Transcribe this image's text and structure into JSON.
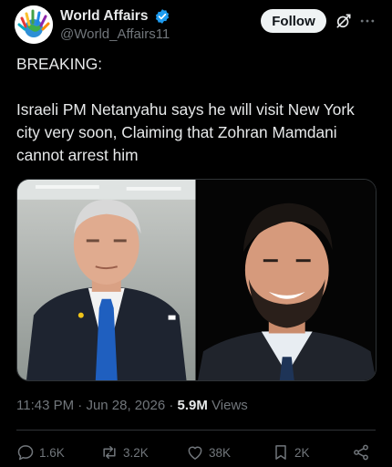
{
  "account": {
    "display_name": "World Affairs",
    "handle": "@World_Affairs11",
    "verified": true,
    "avatar_icon": "globe-hands-avatar",
    "follow_label": "Follow"
  },
  "tweet": {
    "line1": "BREAKING:",
    "line2": "Israeli PM Netanyahu says he will visit New York city very soon, Claiming that Zohran Mamdani cannot arrest him"
  },
  "media": {
    "count": 2,
    "left_icon": "photo-man-suit-blue-tie",
    "right_icon": "photo-man-smiling-beard"
  },
  "meta": {
    "time": "11:43 PM",
    "date": "Jun 28, 2026",
    "separator": "·",
    "views_count": "5.9M",
    "views_label": "Views"
  },
  "actions": {
    "replies": "1.6K",
    "reposts": "3.2K",
    "likes": "38K",
    "bookmarks": "2K"
  },
  "colors": {
    "background": "#000000",
    "text": "#e7e9ea",
    "secondary": "#71767b",
    "verified": "#1d9bf0",
    "follow_bg": "#eff3f4"
  }
}
